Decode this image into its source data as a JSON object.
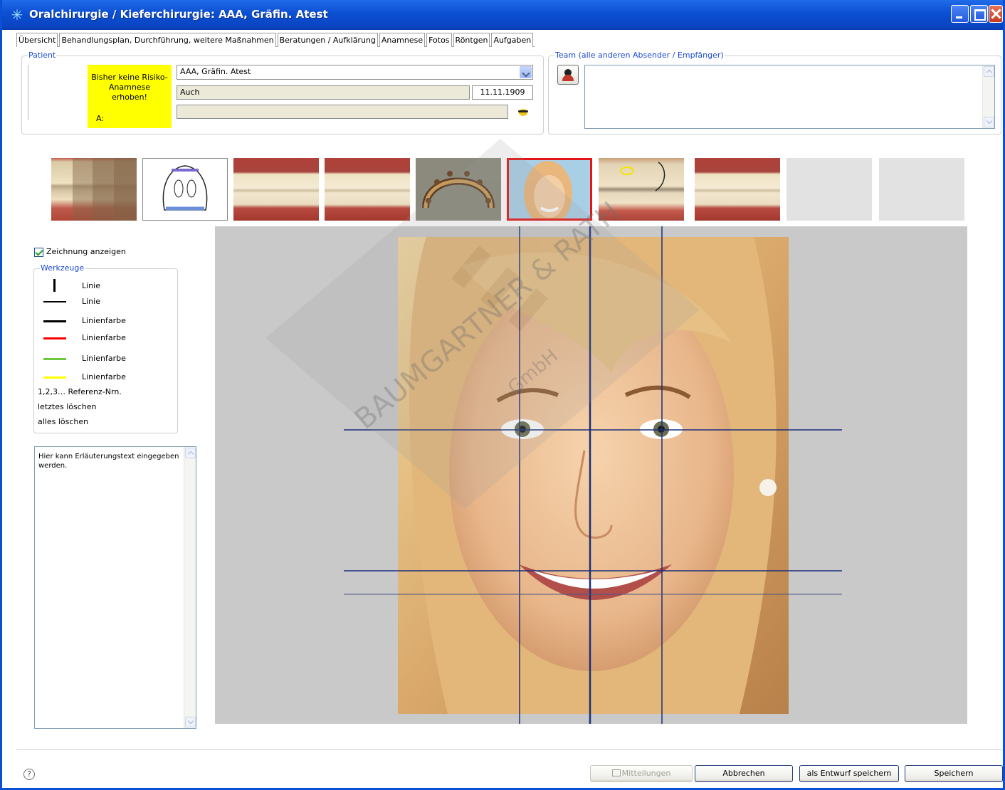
{
  "window": {
    "title": "Oralchirurgie / Kieferchirurgie: AAA, Gräfin. Atest"
  },
  "tabs": [
    {
      "label": "Übersicht"
    },
    {
      "label": "Behandlungsplan, Durchführung, weitere Maßnahmen"
    },
    {
      "label": "Beratungen / Aufklärung"
    },
    {
      "label": "Anamnese"
    },
    {
      "label": "Fotos"
    },
    {
      "label": "Röntgen"
    },
    {
      "label": "Aufgaben"
    }
  ],
  "patient": {
    "legend": "Patient",
    "warning_text": "Bisher keine Risiko-Anamnese erhoben!",
    "warning_a_label": "A:",
    "name_select_value": "AAA, Gräfin. Atest",
    "city": "Auch",
    "birthdate": "11.11.1909",
    "extra": ""
  },
  "team": {
    "legend": "Team (alle anderen Absender / Empfänger)",
    "text": ""
  },
  "thumbnails": [
    {
      "kind": "teeth-closeup"
    },
    {
      "kind": "dental-drawing"
    },
    {
      "kind": "teeth-wide"
    },
    {
      "kind": "teeth-wide"
    },
    {
      "kind": "implant-model"
    },
    {
      "kind": "portrait",
      "selected": "red"
    },
    {
      "kind": "teeth-annotated",
      "selected": "purple"
    },
    {
      "kind": "teeth-wide"
    },
    {
      "kind": "empty"
    },
    {
      "kind": "empty"
    }
  ],
  "drawing": {
    "show_drawing_label": "Zeichnung anzeigen",
    "show_drawing_checked": true,
    "tools_legend": "Werkzeuge",
    "tools": [
      {
        "label": "Linie",
        "kind": "vertical-line",
        "color": "#000000"
      },
      {
        "label": "Linie",
        "kind": "horizontal-line",
        "color": "#000000"
      },
      {
        "label": "Linienfarbe",
        "kind": "color",
        "color": "#000000"
      },
      {
        "label": "Linienfarbe",
        "kind": "color",
        "color": "#ff0000"
      },
      {
        "label": "Linienfarbe",
        "kind": "color",
        "color": "#6cc83c"
      },
      {
        "label": "Linienfarbe",
        "kind": "color",
        "color": "#ffff00"
      }
    ],
    "reference_numbers": "1,2,3… Referenz-Nrn.",
    "delete_last": "letztes löschen",
    "delete_all": "alles löschen",
    "notes_text": "Hier kann Erläuterungstext eingegeben werden."
  },
  "watermark": {
    "text1": "BAUMGARTNER & RATH",
    "text2": "GmbH"
  },
  "buttons": {
    "messages": "Mitteilungen",
    "cancel": "Abbrechen",
    "save_draft": "als Entwurf speichern",
    "save": "Speichern"
  },
  "colors": {
    "titlebar": "#0b4fd2",
    "guide_line": "#1a2f7a",
    "warning_bg": "#ffff00",
    "selection_red": "#e21414",
    "selection_purple": "#8a63c9"
  }
}
